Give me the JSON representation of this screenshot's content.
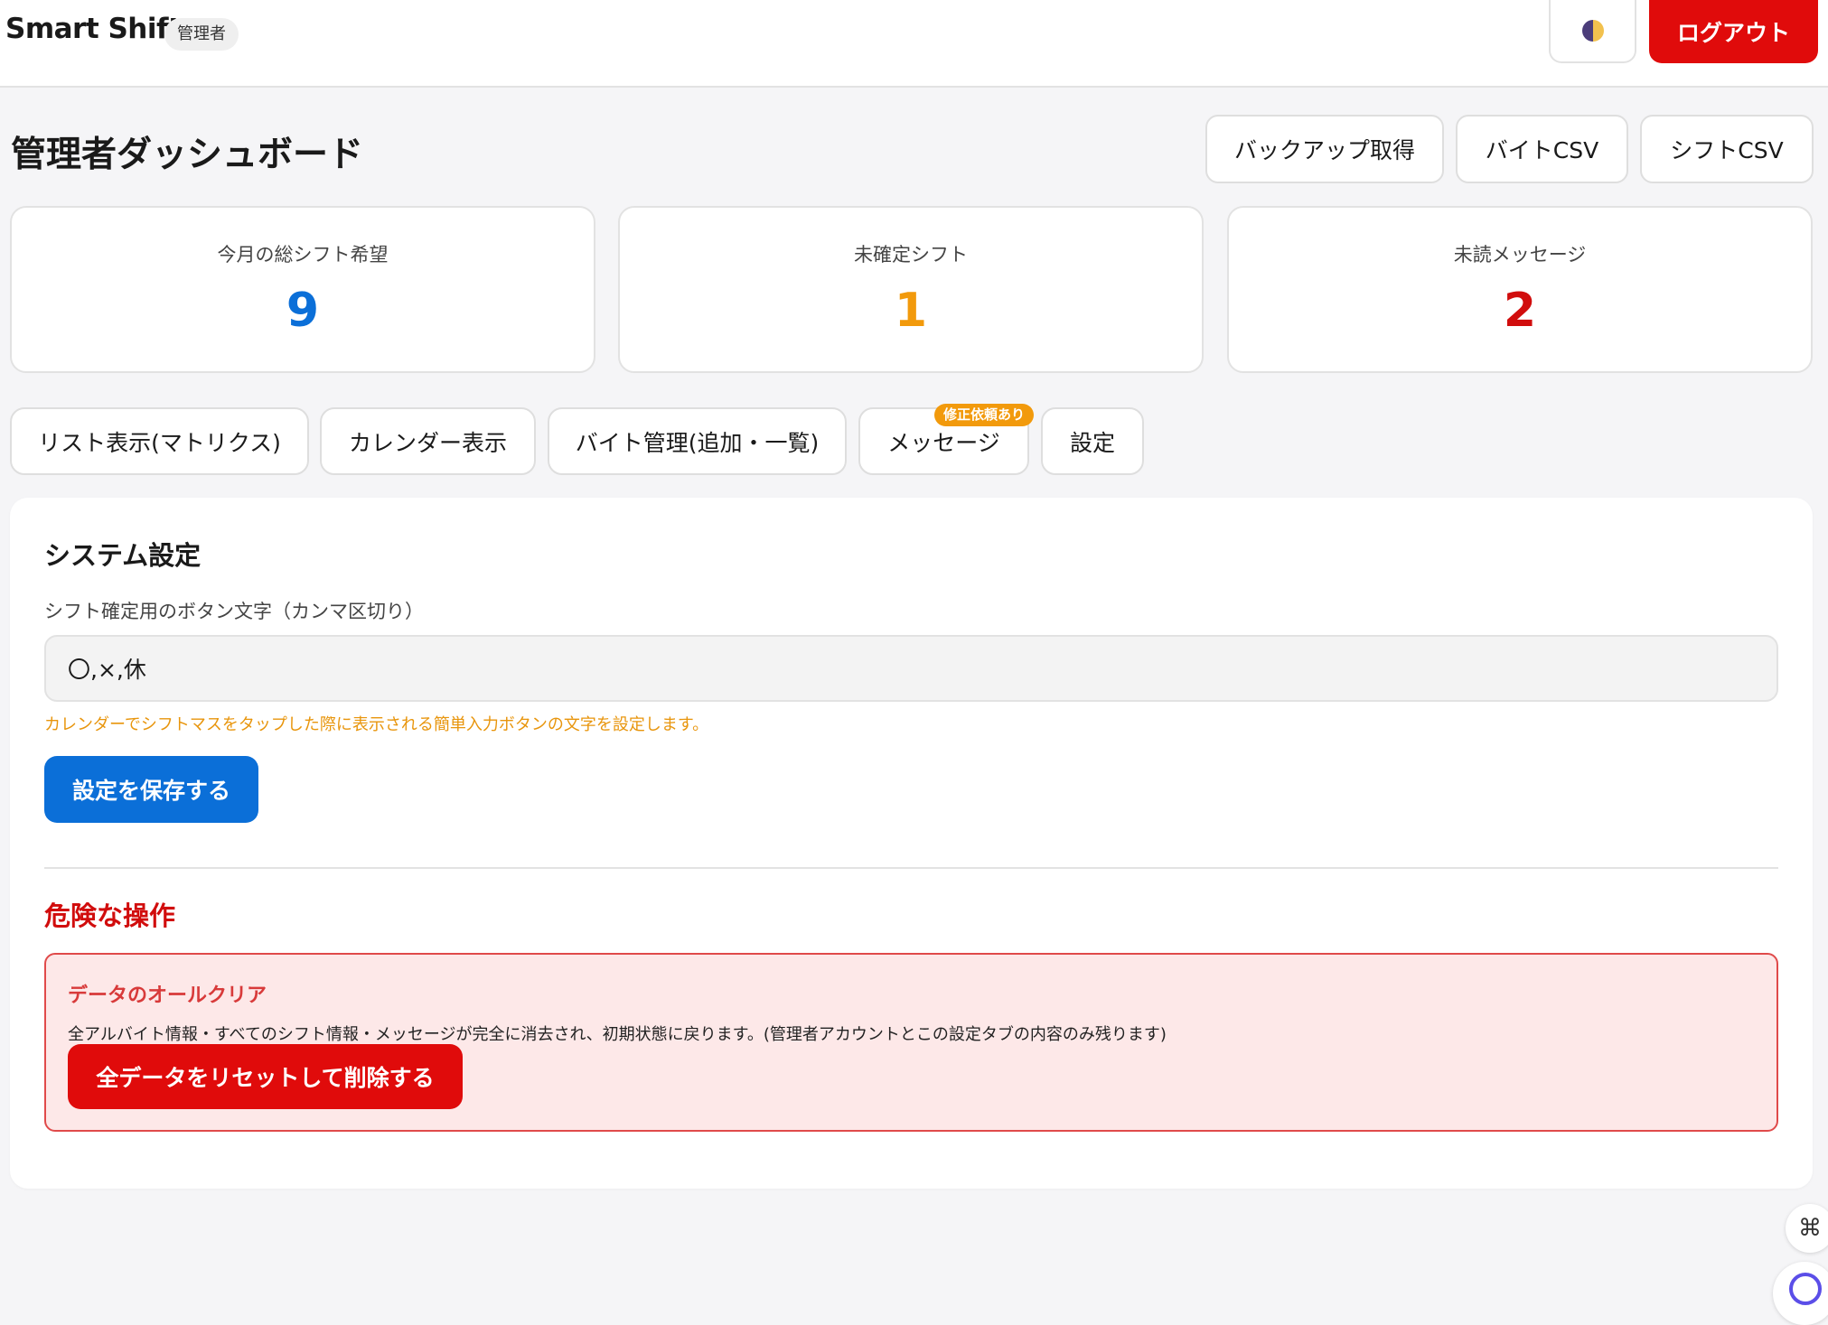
{
  "header": {
    "brand": "Smart Shift",
    "role_badge": "管理者",
    "theme_icon": "half-circle-theme-icon",
    "logout_label": "ログアウト"
  },
  "page": {
    "title": "管理者ダッシュボード",
    "actions": [
      "バックアップ取得",
      "バイトCSV",
      "シフトCSV"
    ]
  },
  "stats": [
    {
      "label": "今月の総シフト希望",
      "value": "9",
      "color": "#0b6fd8"
    },
    {
      "label": "未確定シフト",
      "value": "1",
      "color": "#f29a0c"
    },
    {
      "label": "未読メッセージ",
      "value": "2",
      "color": "#d10d0d"
    }
  ],
  "tabs": [
    {
      "label": "リスト表示(マトリクス)"
    },
    {
      "label": "カレンダー表示"
    },
    {
      "label": "バイト管理(追加・一覧)"
    },
    {
      "label": "メッセージ",
      "badge": "修正依頼あり"
    },
    {
      "label": "設定"
    }
  ],
  "settings": {
    "title": "システム設定",
    "field_label": "シフト確定用のボタン文字（カンマ区切り）",
    "field_value": "〇,×,休",
    "hint": "カレンダーでシフトマスをタップした際に表示される簡単入力ボタンの文字を設定します。",
    "save_label": "設定を保存する"
  },
  "danger": {
    "title": "危険な操作",
    "subtitle": "データのオールクリア",
    "description": "全アルバイト情報・すべてのシフト情報・メッセージが完全に消去され、初期状態に戻ります。(管理者アカウントとこの設定タブの内容のみ残ります)",
    "reset_label": "全データをリセットして削除する"
  },
  "floating": {
    "cmd_glyph": "⌘"
  }
}
